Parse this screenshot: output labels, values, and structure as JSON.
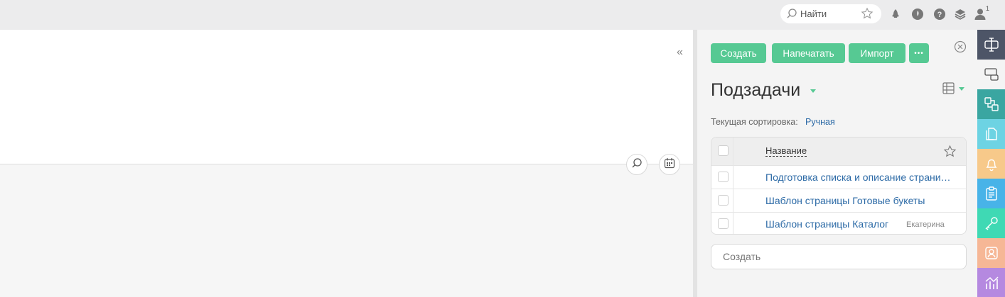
{
  "topbar": {
    "search_placeholder": "Найти",
    "user_badge": "1",
    "icons": [
      "search-icon",
      "star-icon",
      "rocket-icon",
      "leaf-icon",
      "help-icon",
      "layers-icon",
      "user-icon"
    ]
  },
  "panel": {
    "buttons": {
      "create": "Создать",
      "print": "Напечатать",
      "import": "Импорт",
      "more": "•••"
    },
    "title": "Подзадачи",
    "sort_label": "Текущая сортировка:",
    "sort_value": "Ручная",
    "table": {
      "header": "Название",
      "rows": [
        {
          "title": "Подготовка списка и описание страниц сайта",
          "user": ""
        },
        {
          "title": "Шаблон страницы Готовые букеты",
          "user": ""
        },
        {
          "title": "Шаблон страницы Каталог",
          "user": "Екатерина"
        }
      ]
    },
    "create_placeholder": "Создать"
  },
  "sidebar": {
    "items": [
      {
        "icon": "text-cursor-icon",
        "color": "#4d5567"
      },
      {
        "icon": "comments-icon",
        "color": "#f4f4f4"
      },
      {
        "icon": "linked-tasks-icon",
        "color": "#3aa6a1"
      },
      {
        "icon": "files-icon",
        "color": "#6dd3e3"
      },
      {
        "icon": "bell-icon",
        "color": "#f7c98a"
      },
      {
        "icon": "clipboard-icon",
        "color": "#48b3e8"
      },
      {
        "icon": "key-icon",
        "color": "#3fd9b4"
      },
      {
        "icon": "contact-icon",
        "color": "#f6b796"
      },
      {
        "icon": "chart-icon",
        "color": "#b589e0"
      }
    ]
  },
  "colors": {
    "accent": "#56c993",
    "link": "#2c6aa6"
  }
}
